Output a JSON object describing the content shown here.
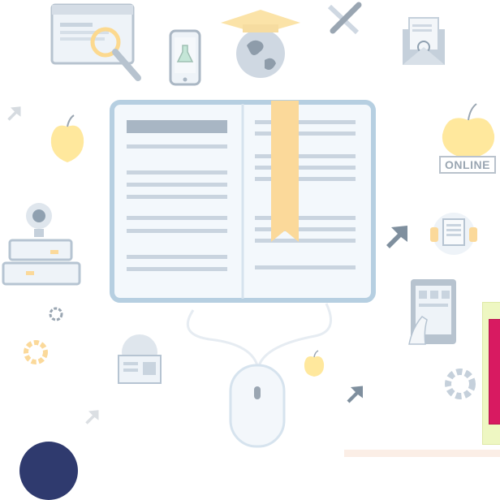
{
  "badge": {
    "online_label": "ONLINE"
  },
  "colors": {
    "book_outline": "#b6cfe1",
    "bookmark": "#fbd99a",
    "card_bg": "#eef7c2",
    "card_accent": "#d81a61",
    "navy": "#2f3a6e",
    "peach": "#fbeee6",
    "apple": "#ffe49a"
  },
  "icons": [
    "browser-search-icon",
    "phone-flask-icon",
    "graduation-globe-icon",
    "pencil-icon",
    "envelope-icon",
    "apple-icon",
    "open-book-icon",
    "bookmark-icon",
    "online-apple-icon",
    "webcam-icon",
    "books-stack-icon",
    "arrow-cursor-icon",
    "headset-icon",
    "gear-icon",
    "globe-document-icon",
    "tablet-touch-icon",
    "mouse-icon"
  ]
}
